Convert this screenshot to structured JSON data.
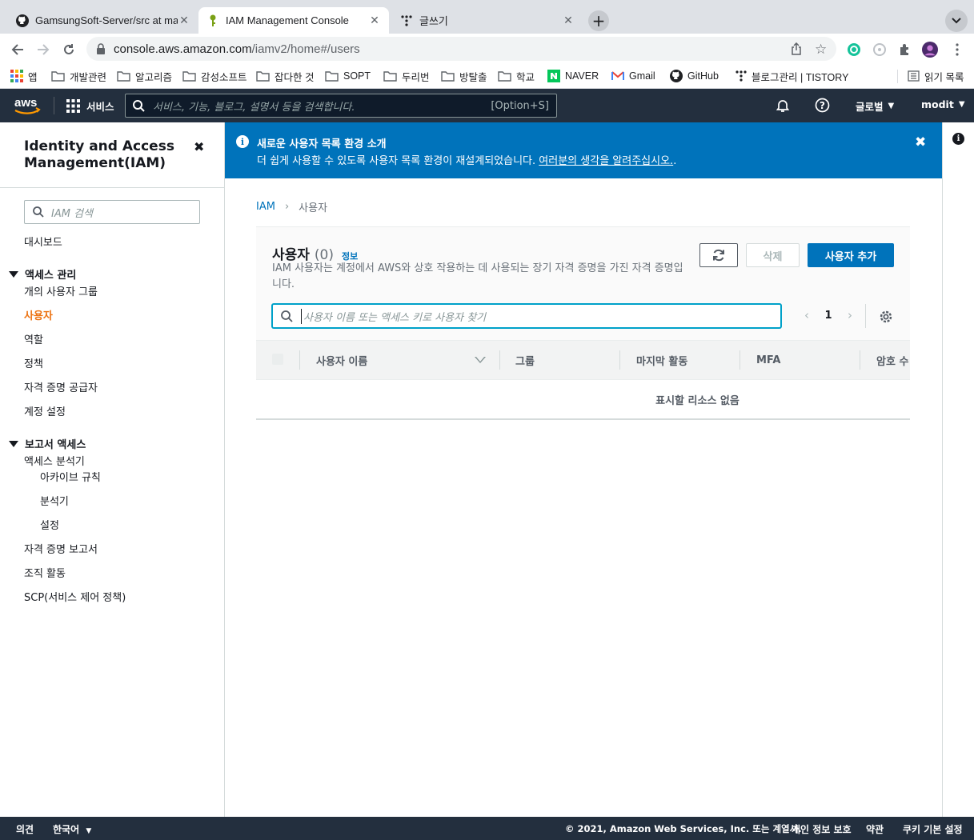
{
  "browser": {
    "tabs": [
      {
        "title": "GamsungSoft-Server/src at ma"
      },
      {
        "title": "IAM Management Console"
      },
      {
        "title": "글쓰기"
      }
    ],
    "url_host": "console.aws.amazon.com",
    "url_path": "/iamv2/home#/users",
    "bookmarks": [
      "앱",
      "개발관련",
      "알고리즘",
      "감성소프트",
      "잡다한 것",
      "SOPT",
      "두리번",
      "방탈출",
      "학교",
      "NAVER",
      "Gmail",
      "GitHub",
      "블로그관리 | TISTORY",
      "읽기 목록"
    ]
  },
  "aws_nav": {
    "logo": "aws",
    "services": "서비스",
    "search_placeholder": "서비스, 기능, 블로그, 설명서 등을 검색합니다.",
    "search_shortcut": "[Option+S]",
    "region": "글로벌",
    "account": "modit"
  },
  "sidebar": {
    "title": "Identity and Access Management(IAM)",
    "search_placeholder": "IAM 검색",
    "dashboard": "대시보드",
    "section_access": "액세스 관리",
    "access_items": [
      "개의 사용자 그룹",
      "사용자",
      "역할",
      "정책",
      "자격 증명 공급자",
      "계정 설정"
    ],
    "section_reports": "보고서 액세스",
    "report_items": [
      "액세스 분석기",
      "아카이브 규칙",
      "분석기",
      "설정",
      "자격 증명 보고서",
      "조직 활동",
      "SCP(서비스 제어 정책)"
    ]
  },
  "flash": {
    "title": "새로운 사용자 목록 환경 소개",
    "text": "더 쉽게 사용할 수 있도록 사용자 목록 환경이 재설계되었습니다. ",
    "link": "여러분의 생각을 알려주십시오.",
    "text_end": "."
  },
  "breadcrumb": {
    "root": "IAM",
    "current": "사용자"
  },
  "users_panel": {
    "title": "사용자",
    "count": "(0)",
    "info": "정보",
    "description": "IAM 사용자는 계정에서 AWS와 상호 작용하는 데 사용되는 장기 자격 증명을 가진 자격 증명입니다.",
    "delete_label": "삭제",
    "add_label": "사용자 추가",
    "search_placeholder": "사용자 이름 또는 액세스 키로 사용자 찾기",
    "page": "1",
    "columns": [
      "사용자 이름",
      "그룹",
      "마지막 활동",
      "MFA",
      "암호 수"
    ],
    "empty_text": "표시할 리소스 없음"
  },
  "footer": {
    "feedback": "의견",
    "language": "한국어",
    "copyright": "© 2021, Amazon Web Services, Inc. 또는 계열사.",
    "privacy": "개인 정보 보호",
    "terms": "약관",
    "cookies": "쿠키 기본 설정"
  },
  "colors": {
    "aws_nav": "#232f3e",
    "flash": "#0073bb",
    "primary": "#0073bb",
    "active_link": "#ec7211"
  }
}
